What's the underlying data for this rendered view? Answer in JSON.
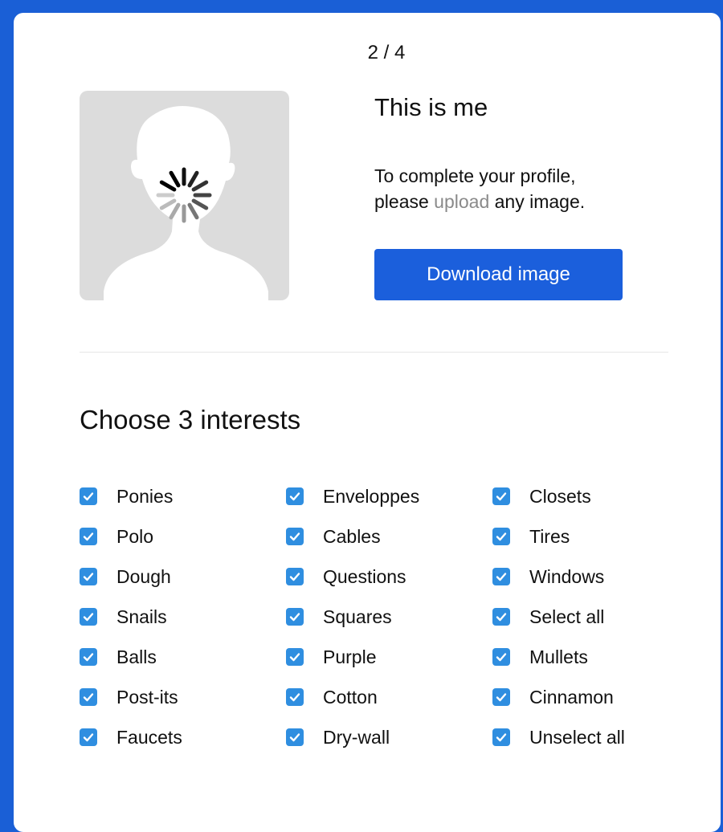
{
  "header": {
    "step": "2 / 4"
  },
  "profile": {
    "avatar_icon": "user-silhouette-icon",
    "loading_icon": "spinner-icon",
    "title": "This is me",
    "description_before": "To complete your profile,",
    "description_please": "please ",
    "description_link": "upload",
    "description_after": " any image.",
    "download_label": "Download image",
    "button_color": "#1b5fdc"
  },
  "interests": {
    "title": "Choose 3 interests",
    "checkbox_color": "#2f8ee0",
    "columns": [
      [
        {
          "label": "Ponies",
          "checked": true
        },
        {
          "label": "Polo",
          "checked": true
        },
        {
          "label": "Dough",
          "checked": true
        },
        {
          "label": "Snails",
          "checked": true
        },
        {
          "label": "Balls",
          "checked": true
        },
        {
          "label": "Post-its",
          "checked": true
        },
        {
          "label": "Faucets",
          "checked": true
        }
      ],
      [
        {
          "label": "Enveloppes",
          "checked": true
        },
        {
          "label": "Cables",
          "checked": true
        },
        {
          "label": "Questions",
          "checked": true
        },
        {
          "label": "Squares",
          "checked": true
        },
        {
          "label": "Purple",
          "checked": true
        },
        {
          "label": "Cotton",
          "checked": true
        },
        {
          "label": "Dry-wall",
          "checked": true
        }
      ],
      [
        {
          "label": "Closets",
          "checked": true
        },
        {
          "label": "Tires",
          "checked": true
        },
        {
          "label": "Windows",
          "checked": true
        },
        {
          "label": "Select all",
          "checked": true
        },
        {
          "label": "Mullets",
          "checked": true
        },
        {
          "label": "Cinnamon",
          "checked": true
        },
        {
          "label": "Unselect all",
          "checked": true
        }
      ]
    ]
  }
}
